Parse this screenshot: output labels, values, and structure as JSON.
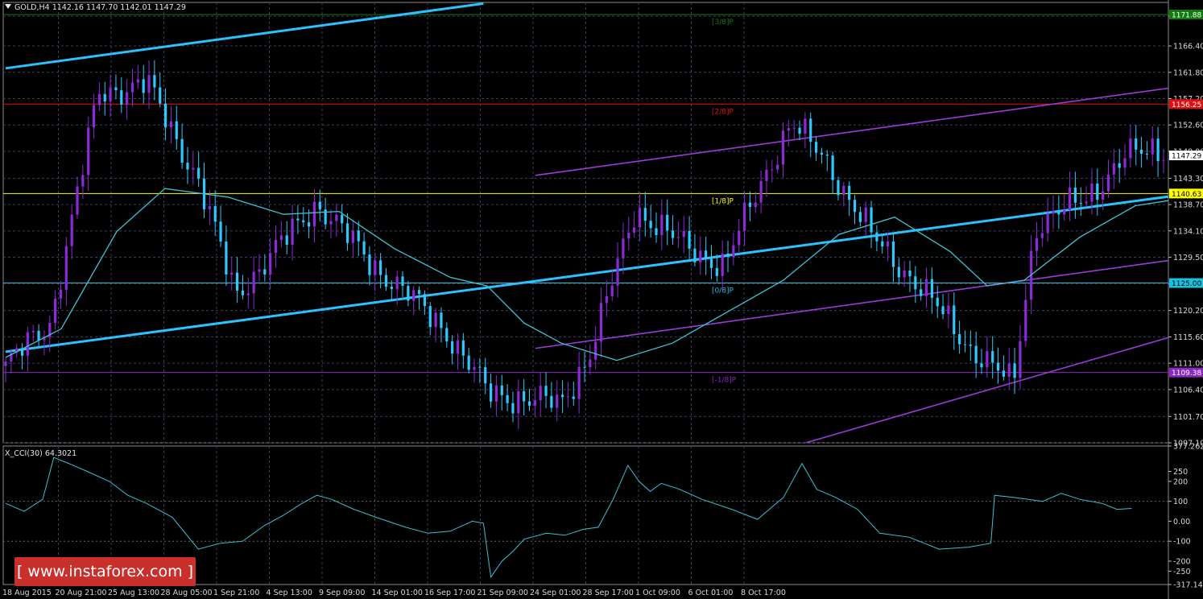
{
  "title": {
    "symbol": "GOLD,H4",
    "ohlc": "1142.16 1147.70 1142.01 1147.29"
  },
  "indicator": {
    "label": "X_CCI(30) 64.3021"
  },
  "brand": {
    "text": "[ www.instaforex.com ]"
  },
  "colors": {
    "background": "#000000",
    "grid": "#33415a",
    "bull": "#8b2ad8",
    "bear": "#2ec8ff",
    "ma": "#3ec4d2",
    "trend": "#2cc2ff",
    "channel": "#9b3bd8",
    "cci": "#36c2d6",
    "level_red": "#e01010",
    "level_yellow": "#ffff00",
    "level_cyan": "#19c3e0",
    "level_purple": "#8a29c0",
    "level_green": "#117a11"
  },
  "chart_data": [
    {
      "type": "candlestick",
      "symbol": "GOLD",
      "timeframe": "H4",
      "ylim": [
        1097.1,
        1174.0
      ],
      "price_ticks": [
        "1171.60",
        "1166.40",
        "1161.80",
        "1157.20",
        "1152.60",
        "1148.00",
        "1143.30",
        "1138.70",
        "1134.10",
        "1129.50",
        "1124.90",
        "1120.20",
        "1115.60",
        "1111.00",
        "1106.40",
        "1101.70",
        "1097.10"
      ],
      "x_ticks": [
        "18 Aug 2015",
        "20 Aug 21:00",
        "25 Aug 13:00",
        "28 Aug 05:00",
        "1 Sep 21:00",
        "4 Sep 13:00",
        "9 Sep 09:00",
        "14 Sep 01:00",
        "16 Sep 17:00",
        "21 Sep 09:00",
        "24 Sep 01:00",
        "28 Sep 17:00",
        "1 Oct 09:00",
        "6 Oct 01:00",
        "8 Oct 17:00"
      ],
      "last_price": {
        "value": 1147.29,
        "label": "1147.29"
      },
      "levels": [
        {
          "name": "[3/8]P",
          "value": 1171.88,
          "label": "1171.88",
          "color": "#117a11"
        },
        {
          "name": "[2/8]P",
          "value": 1156.25,
          "label": "1156.25",
          "color": "#e01010"
        },
        {
          "name": "[1/8]P",
          "value": 1140.63,
          "label": "1140.63",
          "color": "#ffff00"
        },
        {
          "name": "[0/8]P",
          "value": 1125.0,
          "label": "1125.00",
          "color": "#19c3e0"
        },
        {
          "name": "[-1/8]P",
          "value": 1109.38,
          "label": "1109.38",
          "color": "#8a29c0"
        }
      ],
      "candles": {
        "count": 220,
        "close_path": [
          [
            0,
            1110.5
          ],
          [
            12,
            1118.0
          ],
          [
            25,
            1158.0
          ],
          [
            38,
            1160.0
          ],
          [
            52,
            1143.0
          ],
          [
            62,
            1123.0
          ],
          [
            72,
            1130.0
          ],
          [
            84,
            1139.0
          ],
          [
            98,
            1129.0
          ],
          [
            118,
            1117.5
          ],
          [
            130,
            1106.0
          ],
          [
            142,
            1104.5
          ],
          [
            150,
            1104.0
          ],
          [
            158,
            1113.0
          ],
          [
            170,
            1138.0
          ],
          [
            182,
            1132.0
          ],
          [
            194,
            1128.0
          ],
          [
            205,
            1144.0
          ],
          [
            212,
            1153.0
          ],
          [
            222,
            1146.0
          ],
          [
            234,
            1133.0
          ],
          [
            246,
            1125.0
          ],
          [
            260,
            1114.0
          ],
          [
            268,
            1109.5
          ],
          [
            272,
            1107.0
          ],
          [
            278,
            1135.0
          ],
          [
            292,
            1140.0
          ],
          [
            302,
            1147.0
          ],
          [
            312,
            1148.5
          ],
          [
            320,
            1145.0
          ],
          [
            326,
            1147.3
          ]
        ]
      },
      "trend_lines": [
        {
          "start": [
            0,
            1162.5
          ],
          "end": [
            129,
            1173.8
          ]
        },
        {
          "start": [
            0,
            1113.0
          ],
          "end": [
            482,
            1154.6
          ]
        },
        {
          "start": [
            374,
            1097.3
          ],
          "end": [
            482,
            1106.0
          ]
        }
      ],
      "channel_lines": [
        {
          "start": [
            143,
            1143.8
          ],
          "end": [
            482,
            1174.0
          ]
        },
        {
          "start": [
            143,
            1113.6
          ],
          "end": [
            482,
            1144.0
          ]
        },
        {
          "start": [
            216,
            1097.1
          ],
          "end": [
            482,
            1147.0
          ]
        }
      ],
      "moving_average": [
        [
          0,
          1112.0
        ],
        [
          15,
          1117.0
        ],
        [
          30,
          1134.0
        ],
        [
          43,
          1141.5
        ],
        [
          60,
          1140.0
        ],
        [
          75,
          1137.0
        ],
        [
          90,
          1137.5
        ],
        [
          105,
          1131.0
        ],
        [
          120,
          1126.0
        ],
        [
          130,
          1124.5
        ],
        [
          140,
          1118.0
        ],
        [
          150,
          1114.5
        ],
        [
          165,
          1111.5
        ],
        [
          180,
          1114.5
        ],
        [
          195,
          1120.0
        ],
        [
          210,
          1125.5
        ],
        [
          225,
          1133.5
        ],
        [
          240,
          1136.5
        ],
        [
          255,
          1130.5
        ],
        [
          265,
          1124.5
        ],
        [
          275,
          1125.5
        ],
        [
          290,
          1133.0
        ],
        [
          305,
          1138.5
        ],
        [
          315,
          1139.5
        ]
      ]
    },
    {
      "type": "line",
      "name": "X_CCI(30)",
      "value": 64.3021,
      "ylim": [
        -317.1439,
        377.2625
      ],
      "y_ticks": [
        "377.2625",
        "250",
        "200",
        "100",
        "0.00",
        "-100",
        "-200",
        "-250",
        "-317.1439"
      ],
      "series": [
        {
          "values": [
            [
              0,
              90
            ],
            [
              5,
              50
            ],
            [
              10,
              110
            ],
            [
              13,
              320
            ],
            [
              17,
              290
            ],
            [
              22,
              250
            ],
            [
              28,
              200
            ],
            [
              33,
              130
            ],
            [
              38,
              90
            ],
            [
              45,
              20
            ],
            [
              52,
              -140
            ],
            [
              58,
              -110
            ],
            [
              64,
              -100
            ],
            [
              70,
              -20
            ],
            [
              75,
              30
            ],
            [
              80,
              90
            ],
            [
              84,
              130
            ],
            [
              88,
              110
            ],
            [
              94,
              60
            ],
            [
              100,
              20
            ],
            [
              108,
              -30
            ],
            [
              114,
              -60
            ],
            [
              120,
              -50
            ],
            [
              126,
              0
            ],
            [
              129,
              -10
            ],
            [
              131,
              -280
            ],
            [
              134,
              -200
            ],
            [
              137,
              -150
            ],
            [
              140,
              -90
            ],
            [
              146,
              -60
            ],
            [
              151,
              -70
            ],
            [
              156,
              -40
            ],
            [
              160,
              -30
            ],
            [
              164,
              110
            ],
            [
              168,
              280
            ],
            [
              171,
              200
            ],
            [
              174,
              150
            ],
            [
              177,
              190
            ],
            [
              182,
              160
            ],
            [
              188,
              110
            ],
            [
              196,
              60
            ],
            [
              203,
              10
            ],
            [
              210,
              120
            ],
            [
              215,
              290
            ],
            [
              219,
              160
            ],
            [
              224,
              120
            ],
            [
              230,
              60
            ],
            [
              236,
              -60
            ],
            [
              244,
              -80
            ],
            [
              252,
              -140
            ],
            [
              260,
              -130
            ],
            [
              266,
              -110
            ],
            [
              267,
              130
            ],
            [
              272,
              120
            ],
            [
              280,
              100
            ],
            [
              285,
              140
            ],
            [
              290,
              110
            ],
            [
              296,
              90
            ],
            [
              300,
              60
            ],
            [
              304,
              64.3
            ]
          ]
        }
      ]
    }
  ]
}
